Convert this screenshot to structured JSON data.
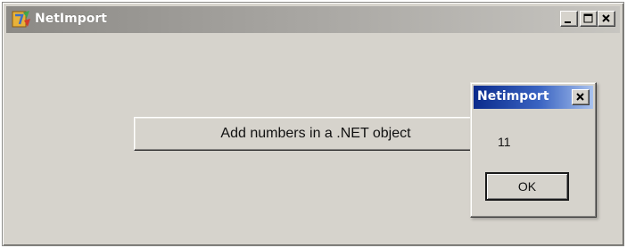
{
  "main_window": {
    "title": "NetImport",
    "icon": "netimport-app-icon",
    "controls": {
      "minimize": "minimize-icon",
      "maximize": "maximize-icon",
      "close": "close-icon"
    },
    "action_button_label": "Add numbers in a .NET object"
  },
  "message_box": {
    "title": "Netimport",
    "close_icon": "close-icon",
    "message": "11",
    "ok_label": "OK"
  },
  "colors": {
    "window_face": "#d6d3cc",
    "inactive_titlebar": "#a9a7a3",
    "active_titlebar": "#0a2a8c"
  }
}
